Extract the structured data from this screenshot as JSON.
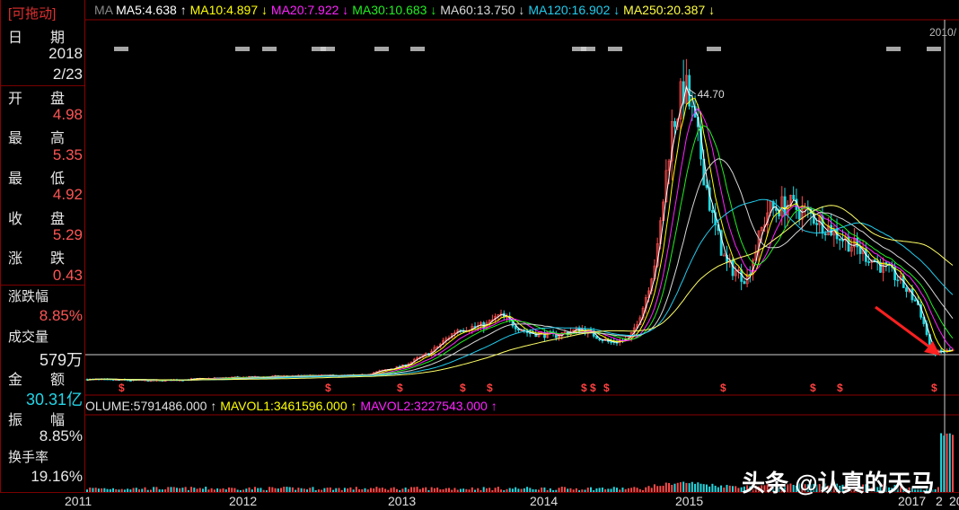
{
  "sidebar": {
    "tag": "[可拖动]",
    "date_label": "日",
    "date_label2": "期",
    "year": "2018",
    "date": "2/23",
    "open_label": "开",
    "open_label2": "盘",
    "open": "4.98",
    "high_label": "最",
    "high_label2": "高",
    "high": "5.35",
    "low_label": "最",
    "low_label2": "低",
    "low": "4.92",
    "close_label": "收",
    "close_label2": "盘",
    "close": "5.29",
    "change_label": "涨",
    "change_label2": "跌",
    "change": "0.43",
    "pct_label": "涨跌幅",
    "pct": "8.85%",
    "vol_label": "成交量",
    "vol": "579万",
    "amt_label": "金",
    "amt_label2": "额",
    "amt": "30.31亿",
    "amp_label": "振",
    "amp_label2": "幅",
    "amp": "8.85%",
    "turn_label": "换手率",
    "turn": "19.16%"
  },
  "ma_bar": {
    "prefix": "MA",
    "items": [
      {
        "text": "MA5:4.638",
        "arrow": "↑",
        "color": "#ffffff"
      },
      {
        "text": "MA10:4.897",
        "arrow": "↓",
        "color": "#ffff00"
      },
      {
        "text": "MA20:7.922",
        "arrow": "↓",
        "color": "#ff22ff"
      },
      {
        "text": "MA30:10.683",
        "arrow": "↓",
        "color": "#22ee22"
      },
      {
        "text": "MA60:13.750",
        "arrow": "↓",
        "color": "#d8d8d8"
      },
      {
        "text": "MA120:16.902",
        "arrow": "↓",
        "color": "#22ccee"
      },
      {
        "text": "MA250:20.387",
        "arrow": "↓",
        "color": "#ffff44"
      }
    ]
  },
  "vol_bar": {
    "items": [
      {
        "text": "OLUME:5791486.000",
        "arrow": "↑",
        "color": "#e0e0e0"
      },
      {
        "text": "MAVOL1:3461596.000",
        "arrow": "↑",
        "color": "#ffff00"
      },
      {
        "text": "MAVOL2:3227543.000",
        "arrow": "↑",
        "color": "#ff22ff"
      }
    ]
  },
  "corner_label": "2010/",
  "colors": {
    "up": "#ff4a4a",
    "down": "#22d8e0",
    "ma5": "#ffffff",
    "ma10": "#ffff00",
    "ma20": "#ff22ff",
    "ma30": "#22ee22",
    "ma60": "#d8d8d8",
    "ma120": "#22ccee",
    "ma250": "#ffff66",
    "grid": "#8a0000"
  },
  "x_labels": [
    "2011",
    "2012",
    "2013",
    "2014",
    "2015",
    "2017",
    "2",
    "20"
  ],
  "watermark": "头条 @认真的天马",
  "chart_data": {
    "type": "line",
    "title": "",
    "xlabel": "",
    "ylabel": "",
    "x": [
      2011.0,
      2011.5,
      2012.0,
      2012.5,
      2013.0,
      2013.3,
      2013.5,
      2013.7,
      2013.9,
      2014.0,
      2014.2,
      2014.4,
      2014.6,
      2014.8,
      2014.95,
      2015.05,
      2015.15,
      2015.25,
      2015.35,
      2015.45,
      2015.55,
      2015.65,
      2015.8,
      2015.95,
      2016.1,
      2016.3,
      2016.5,
      2016.7,
      2016.9,
      2017.05,
      2017.15,
      2017.3
    ],
    "series": [
      {
        "name": "",
        "values": [
          1.0,
          0.8,
          1.2,
          1.5,
          1.6,
          3.0,
          5.0,
          8.5,
          9.0,
          10.5,
          8.0,
          7.5,
          8.5,
          6.5,
          7.0,
          12.0,
          20.0,
          38.0,
          44.7,
          36.0,
          25.0,
          18.0,
          16.0,
          26.0,
          27.0,
          25.0,
          22.0,
          19.0,
          16.0,
          12.0,
          4.9,
          5.29
        ]
      }
    ],
    "ylim": [
      0,
      48
    ],
    "annotations": [
      {
        "text": "44.70",
        "x": 2015.35,
        "y": 44.7
      }
    ]
  }
}
